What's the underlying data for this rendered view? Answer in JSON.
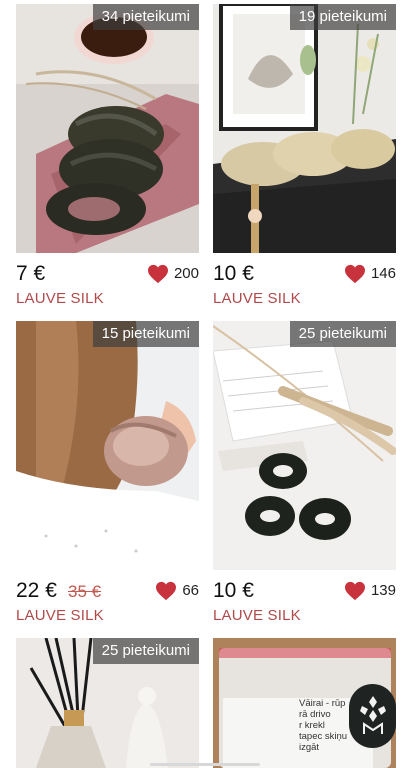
{
  "products": [
    {
      "requests": "34 pieteikumi",
      "price": "7 €",
      "old_price": "",
      "likes": "200",
      "seller": "LAUVE SILK",
      "image": "green-silk-scrunchies-with-coffee-and-book"
    },
    {
      "requests": "19 pieteikumi",
      "price": "10 €",
      "old_price": "",
      "likes": "146",
      "seller": "LAUVE SILK",
      "image": "champagne-silk-scrunchies-on-gift-box"
    },
    {
      "requests": "15 pieteikumi",
      "price": "22 €",
      "old_price": "35 €",
      "likes": "66",
      "seller": "LAUVE SILK",
      "image": "pink-silk-scrunchie-on-wrist"
    },
    {
      "requests": "25 pieteikumi",
      "price": "10 €",
      "old_price": "",
      "likes": "139",
      "seller": "LAUVE SILK",
      "image": "three-black-silk-scrunchies-with-dried-grass"
    },
    {
      "requests": "25 pieteikumi",
      "image": "reed-diffuser-and-candle"
    },
    {
      "requests": "",
      "image": "clothing-in-plastic-bag",
      "bag_text": [
        "Vāirai - rūp",
        "rā drivo",
        "r krekl",
        "tapec skiņu",
        "izgāt"
      ]
    }
  ],
  "icons": {
    "like": "heart-icon",
    "brand": "brand-logo-icon"
  },
  "colors": {
    "accent": "#b14a4a",
    "heart": "#c8323c",
    "badge_bg": "#3c3c3c"
  }
}
